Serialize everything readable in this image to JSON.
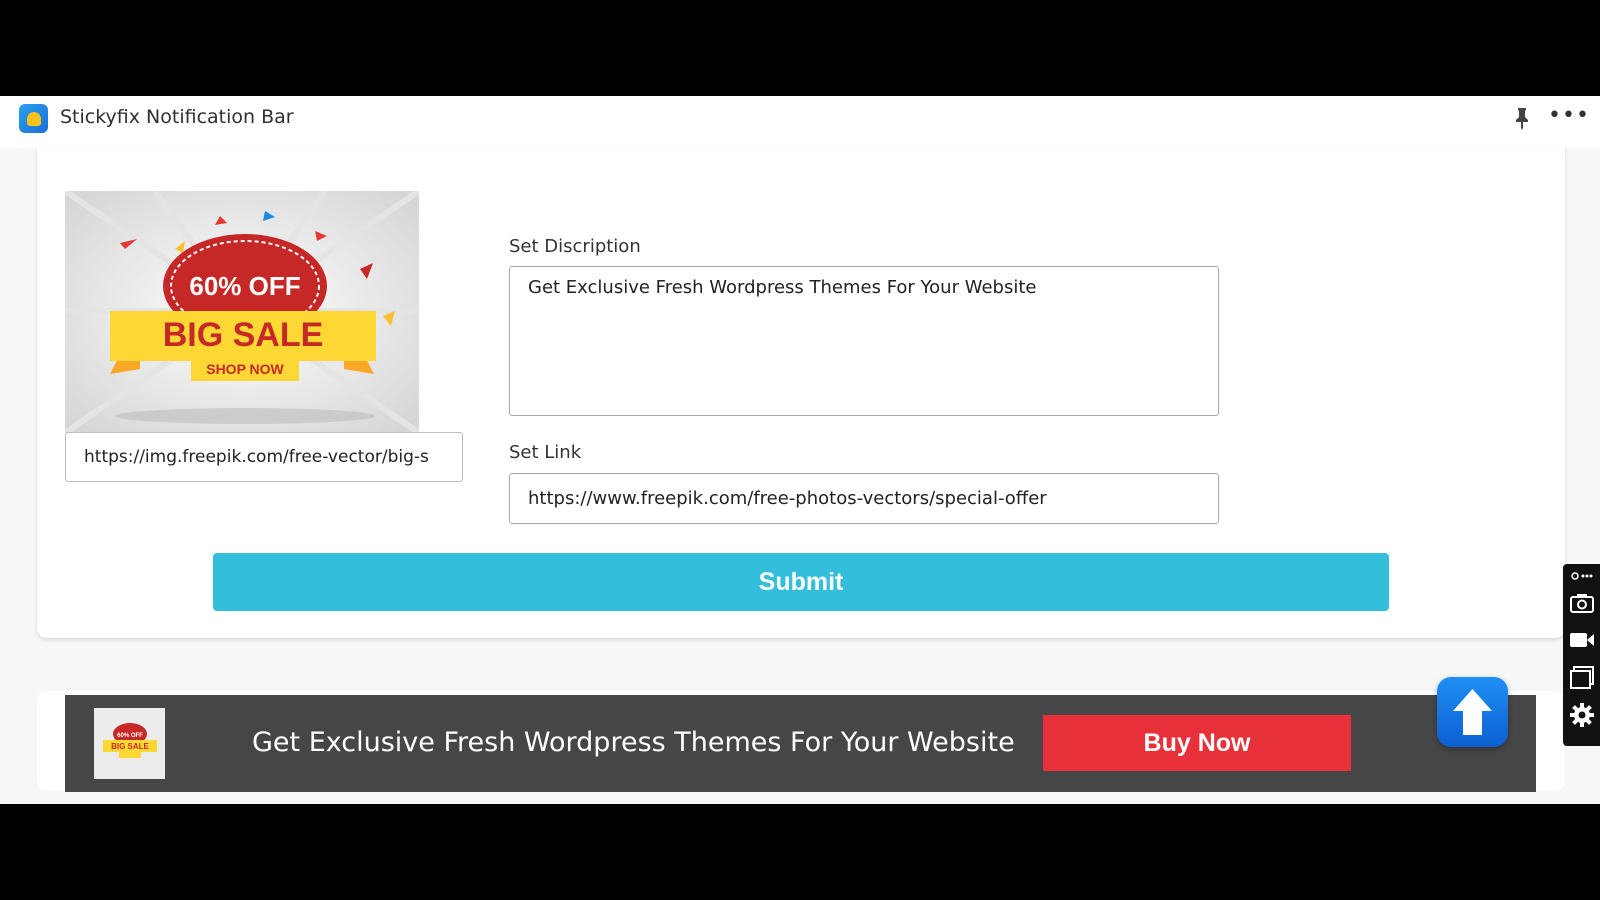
{
  "window": {
    "title": "Stickyfix Notification Bar"
  },
  "form": {
    "image_url": "https://img.freepik.com/free-vector/big-s",
    "description_label": "Set Discription",
    "description_value": "Get Exclusive Fresh Wordpress Themes For Your Website",
    "link_label": "Set Link",
    "link_value": "https://www.freepik.com/free-photos-vectors/special-offer",
    "submit_label": "Submit"
  },
  "promo_image": {
    "badge_text": "60% OFF",
    "headline": "BIG SALE",
    "cta": "SHOP NOW"
  },
  "notification_bar": {
    "text": "Get Exclusive Fresh Wordpress Themes For Your Website",
    "button_label": "Buy Now",
    "thumb_badge": "60% OFF",
    "thumb_headline": "BIG SALE"
  },
  "colors": {
    "submit": "#33bfdb",
    "buy_now": "#e8303a",
    "bar_background": "#464646"
  },
  "icons": [
    "pin-icon",
    "more-icon",
    "arrow-up-icon",
    "camera-icon",
    "video-icon",
    "window-icon",
    "settings-icon"
  ]
}
